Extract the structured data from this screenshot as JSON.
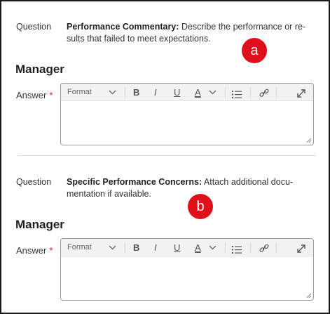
{
  "sections": [
    {
      "question_label": "Question",
      "question_title": "Performance Commentary:",
      "question_text_line1": " Describe the performance or re-",
      "question_text_line2": "sults that failed to meet expectations.",
      "badge": "a",
      "role_heading": "Manager",
      "answer_label": "Answer",
      "required_marker": "*",
      "toolbar": {
        "format_label": "Format",
        "bold": "B",
        "italic": "I",
        "underline": "U",
        "font_color": "A"
      }
    },
    {
      "question_label": "Question",
      "question_title": "Specific Performance Concerns:",
      "question_text_line1": " Attach additional docu-",
      "question_text_line2": "mentation if available.",
      "badge": "b",
      "role_heading": "Manager",
      "answer_label": "Answer",
      "required_marker": "*",
      "toolbar": {
        "format_label": "Format",
        "bold": "B",
        "italic": "I",
        "underline": "U",
        "font_color": "A"
      }
    }
  ],
  "colors": {
    "badge": "#e0101a",
    "required": "#d61a1a",
    "toolbar_bg": "#f2f2f2"
  },
  "icons": [
    "chevron-down-icon",
    "bulleted-list-icon",
    "link-icon",
    "expand-icon",
    "resize-handle-icon"
  ]
}
